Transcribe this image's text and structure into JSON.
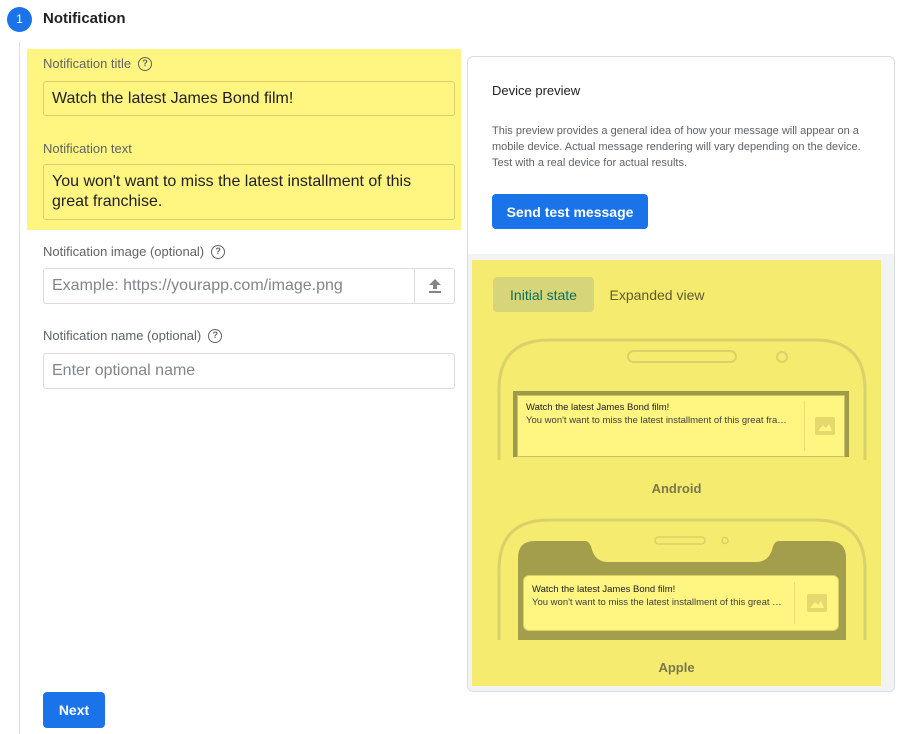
{
  "step": {
    "number": "1",
    "title": "Notification"
  },
  "form": {
    "title_label": "Notification title",
    "title_value": "Watch the latest James Bond film!",
    "text_label": "Notification text",
    "text_value": "You won't want to miss the latest installment of this great franchise.",
    "image_label": "Notification image (optional)",
    "image_placeholder": "Example: https://yourapp.com/image.png",
    "name_label": "Notification name (optional)",
    "name_placeholder": "Enter optional name",
    "next_label": "Next"
  },
  "preview": {
    "title": "Device preview",
    "description": "This preview provides a general idea of how your message will appear on a mobile device. Actual message rendering will vary depending on the device. Test with a real device for actual results.",
    "send_test_label": "Send test message",
    "tabs": [
      {
        "label": "Initial state",
        "active": true
      },
      {
        "label": "Expanded view",
        "active": false
      }
    ],
    "android": {
      "label": "Android",
      "notif_title": "Watch the latest James Bond film!",
      "notif_text": "You won't want to miss the latest installment of this great franchise."
    },
    "apple": {
      "label": "Apple",
      "notif_title": "Watch the latest James Bond film!",
      "notif_text": "You won't want to miss the latest installment of this great franchise."
    }
  },
  "colors": {
    "primary": "#1a73e8",
    "highlight": "#fff580",
    "preview_highlight": "#f5eb6e"
  },
  "icons": {
    "help": "help-circle-icon",
    "upload": "upload-icon",
    "image": "image-placeholder-icon"
  }
}
